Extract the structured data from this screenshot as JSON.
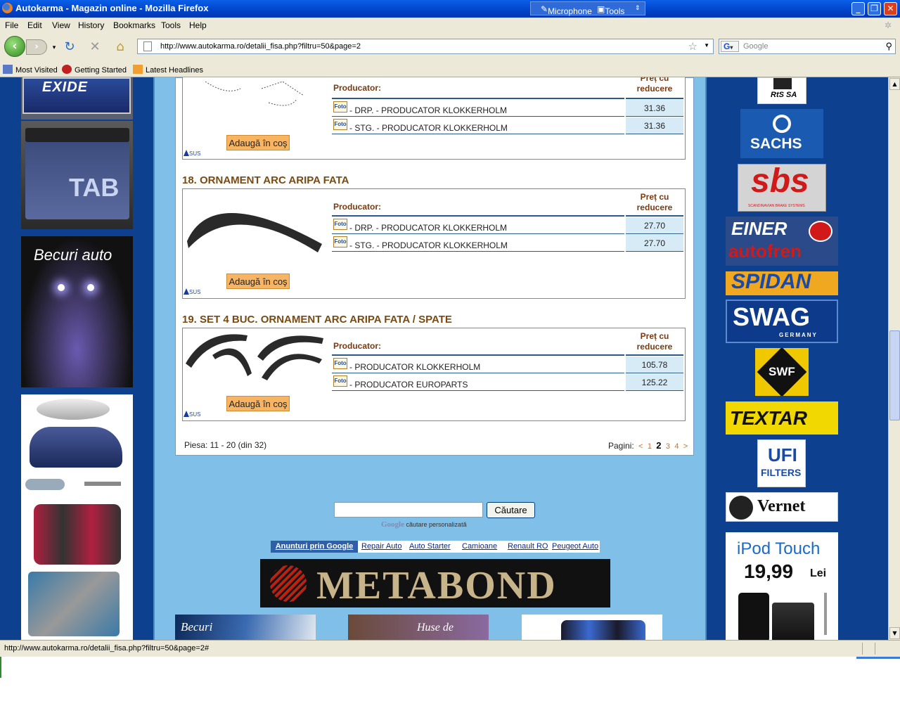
{
  "window": {
    "title": "Autokarma - Magazin online - Mozilla Firefox",
    "langbar_mic": "Microphone",
    "langbar_tools": "Tools"
  },
  "menu": [
    "File",
    "Edit",
    "View",
    "History",
    "Bookmarks",
    "Tools",
    "Help"
  ],
  "nav": {
    "url": "http://www.autokarma.ro/detalii_fisa.php?filtru=50&page=2",
    "search_placeholder": "Google"
  },
  "bookmarks": [
    "Most Visited",
    "Getting Started",
    "Latest Headlines"
  ],
  "left_ads": {
    "battery_brand": "EXIDE",
    "battery2_brand": "TAB",
    "bulbs": "Becuri auto"
  },
  "products": [
    {
      "number_title": "",
      "header_producator": "Producator:",
      "header_pret": "Preț cu reducere",
      "rows": [
        {
          "foto": "Foto",
          "name": "- DRP. - PRODUCATOR KLOKKERHOLM",
          "price": "31.36"
        },
        {
          "foto": "Foto",
          "name": "- STG. - PRODUCATOR KLOKKERHOLM",
          "price": "31.36"
        }
      ],
      "add_label": "Adaugă în coş",
      "sus": "SUS"
    },
    {
      "number_title": "18. ORNAMENT ARC ARIPA FATA",
      "header_producator": "Producator:",
      "header_pret": "Preț cu reducere",
      "rows": [
        {
          "foto": "Foto",
          "name": "- DRP. - PRODUCATOR KLOKKERHOLM",
          "price": "27.70"
        },
        {
          "foto": "Foto",
          "name": "- STG. - PRODUCATOR KLOKKERHOLM",
          "price": "27.70"
        }
      ],
      "add_label": "Adaugă în coş",
      "sus": "SUS"
    },
    {
      "number_title": "19. SET 4 BUC. ORNAMENT ARC ARIPA FATA / SPATE",
      "header_producator": "Producator:",
      "header_pret": "Preț cu reducere",
      "rows": [
        {
          "foto": "Foto",
          "name": "- PRODUCATOR KLOKKERHOLM",
          "price": "105.78"
        },
        {
          "foto": "Foto",
          "name": "- PRODUCATOR EUROPARTS",
          "price": "125.22"
        }
      ],
      "add_label": "Adaugă în coş",
      "sus": "SUS"
    }
  ],
  "pagination": {
    "piesa": "Piesa: 11 - 20 (din 32)",
    "label": "Pagini:",
    "prev": "<",
    "p1": "1",
    "current": "2",
    "p3": "3",
    "p4": "4",
    "next": ">"
  },
  "gsearch": {
    "button": "Căutare",
    "custom": "căutare personalizată",
    "google": "Google"
  },
  "adlinks": {
    "heading": "Anunturi prin Google",
    "links": [
      "Repair Auto",
      "Auto Starter",
      "Camioane",
      "Renault RO",
      "Peugeot Auto"
    ]
  },
  "banner": {
    "metabond": "METABOND",
    "bottom1": "Becuri",
    "bottom2": "Huse de"
  },
  "right_logos": [
    "RtS SA",
    "SACHS",
    "sbs",
    "SCANDINAVIAN BRAKE SYSTEMS",
    "EINER",
    "autofren",
    "SPIDAN",
    "SWAG",
    "GERMANY",
    "SWF",
    "TEXTAR",
    "UFI",
    "FILTERS",
    "Vernet"
  ],
  "ipod": {
    "title": "iPod Touch",
    "price": "19,99",
    "currency": "Lei"
  },
  "status": {
    "text": "http://www.autokarma.ro/detalii_fisa.php?filtru=50&page=2#"
  }
}
